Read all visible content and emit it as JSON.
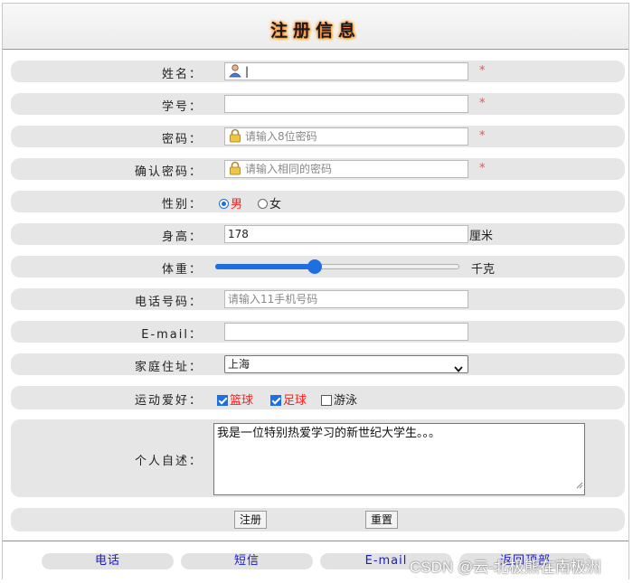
{
  "title": "注册信息",
  "name": {
    "label": "姓名：",
    "value": "",
    "required": "*"
  },
  "student_id": {
    "label": "学号：",
    "value": "",
    "required": "*"
  },
  "password": {
    "label": "密码：",
    "placeholder": "请输入8位密码",
    "required": "*"
  },
  "confirm_password": {
    "label": "确认密码：",
    "placeholder": "请输入相同的密码",
    "required": "*"
  },
  "gender": {
    "label": "性别：",
    "options": [
      "男",
      "女"
    ],
    "selected": "男"
  },
  "height": {
    "label": "身高：",
    "value": "178",
    "unit": "厘米"
  },
  "weight": {
    "label": "体重：",
    "unit": "千克",
    "slider_fraction": 0.4
  },
  "phone": {
    "label": "电话号码：",
    "placeholder": "请输入11手机号码"
  },
  "email": {
    "label": "E-mail：",
    "value": ""
  },
  "address": {
    "label": "家庭住址：",
    "selected": "上海"
  },
  "hobbies": {
    "label": "运动爱好：",
    "items": [
      {
        "text": "篮球",
        "checked": true
      },
      {
        "text": "足球",
        "checked": true
      },
      {
        "text": "游泳",
        "checked": false
      }
    ]
  },
  "bio": {
    "label": "个人自述：",
    "value": "我是一位特别热爱学习的新世纪大学生。。。"
  },
  "buttons": {
    "register": "注册",
    "reset": "重置"
  },
  "footer": {
    "links": [
      "电话",
      "短信",
      "E-mail",
      "返回顶部"
    ]
  },
  "watermark": "CSDN @云-北极熊在南极洲",
  "colors": {
    "required_star": "#ff4a4a",
    "checked_label": "#ff2020",
    "link": "#1a1acc",
    "accent": "#1e6fe0"
  },
  "icons": {
    "name_field": "user-icon",
    "password_field": "lock-icon"
  }
}
